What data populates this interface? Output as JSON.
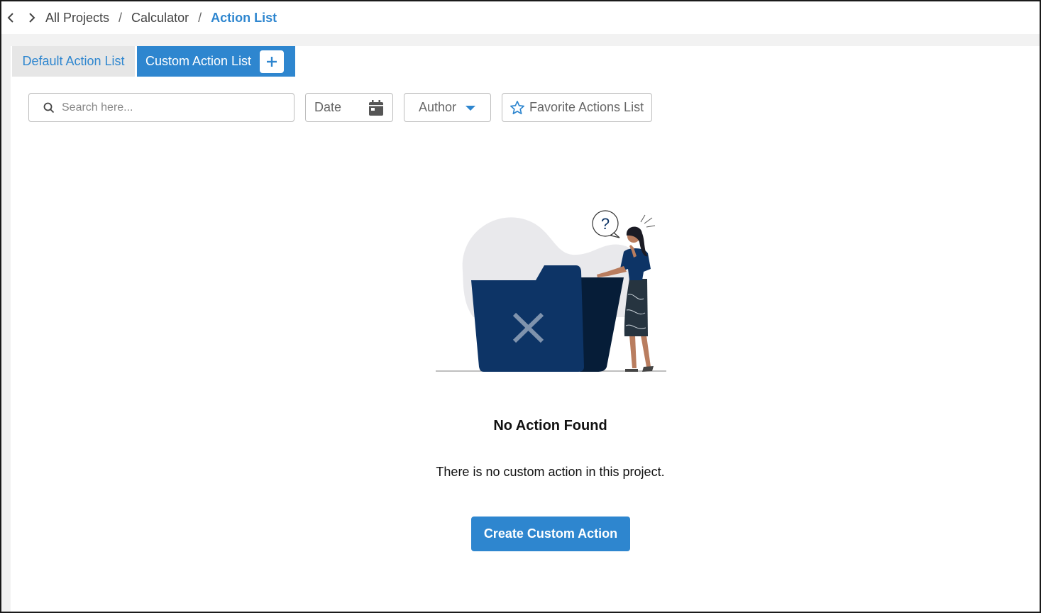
{
  "breadcrumb": {
    "items": [
      "All Projects",
      "Calculator",
      "Action List"
    ],
    "separator": "/"
  },
  "tabs": {
    "default_label": "Default Action List",
    "custom_label": "Custom Action List"
  },
  "filters": {
    "search_placeholder": "Search here...",
    "date_label": "Date",
    "author_label": "Author",
    "favorite_label": "Favorite Actions List"
  },
  "empty_state": {
    "title": "No Action Found",
    "description": "There is no custom action in this project.",
    "button_label": "Create Custom Action"
  },
  "colors": {
    "accent": "#2e86cf",
    "folder": "#0d3466"
  }
}
